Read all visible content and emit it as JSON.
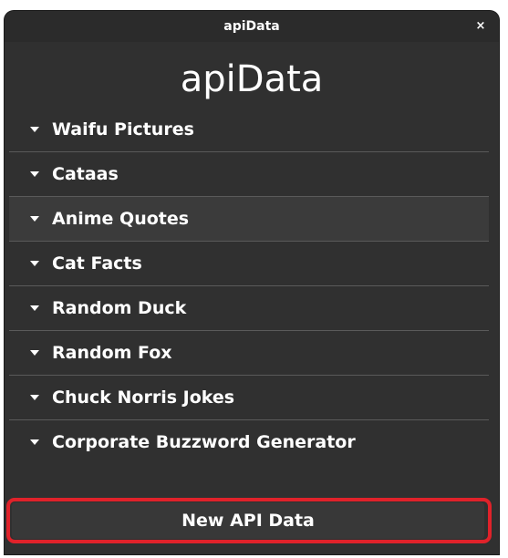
{
  "window": {
    "title": "apiData",
    "close_label": "×"
  },
  "app": {
    "heading": "apiData"
  },
  "sections": [
    {
      "label": "Waifu Pictures"
    },
    {
      "label": "Cataas"
    },
    {
      "label": "Anime Quotes"
    },
    {
      "label": "Cat Facts"
    },
    {
      "label": "Random Duck"
    },
    {
      "label": "Random Fox"
    },
    {
      "label": "Chuck Norris Jokes"
    },
    {
      "label": "Corporate Buzzword Generator"
    }
  ],
  "actions": {
    "new_data_label": "New API Data"
  },
  "colors": {
    "window_bg": "#303030",
    "text": "#ffffff",
    "highlight_outline": "#e0222a"
  }
}
